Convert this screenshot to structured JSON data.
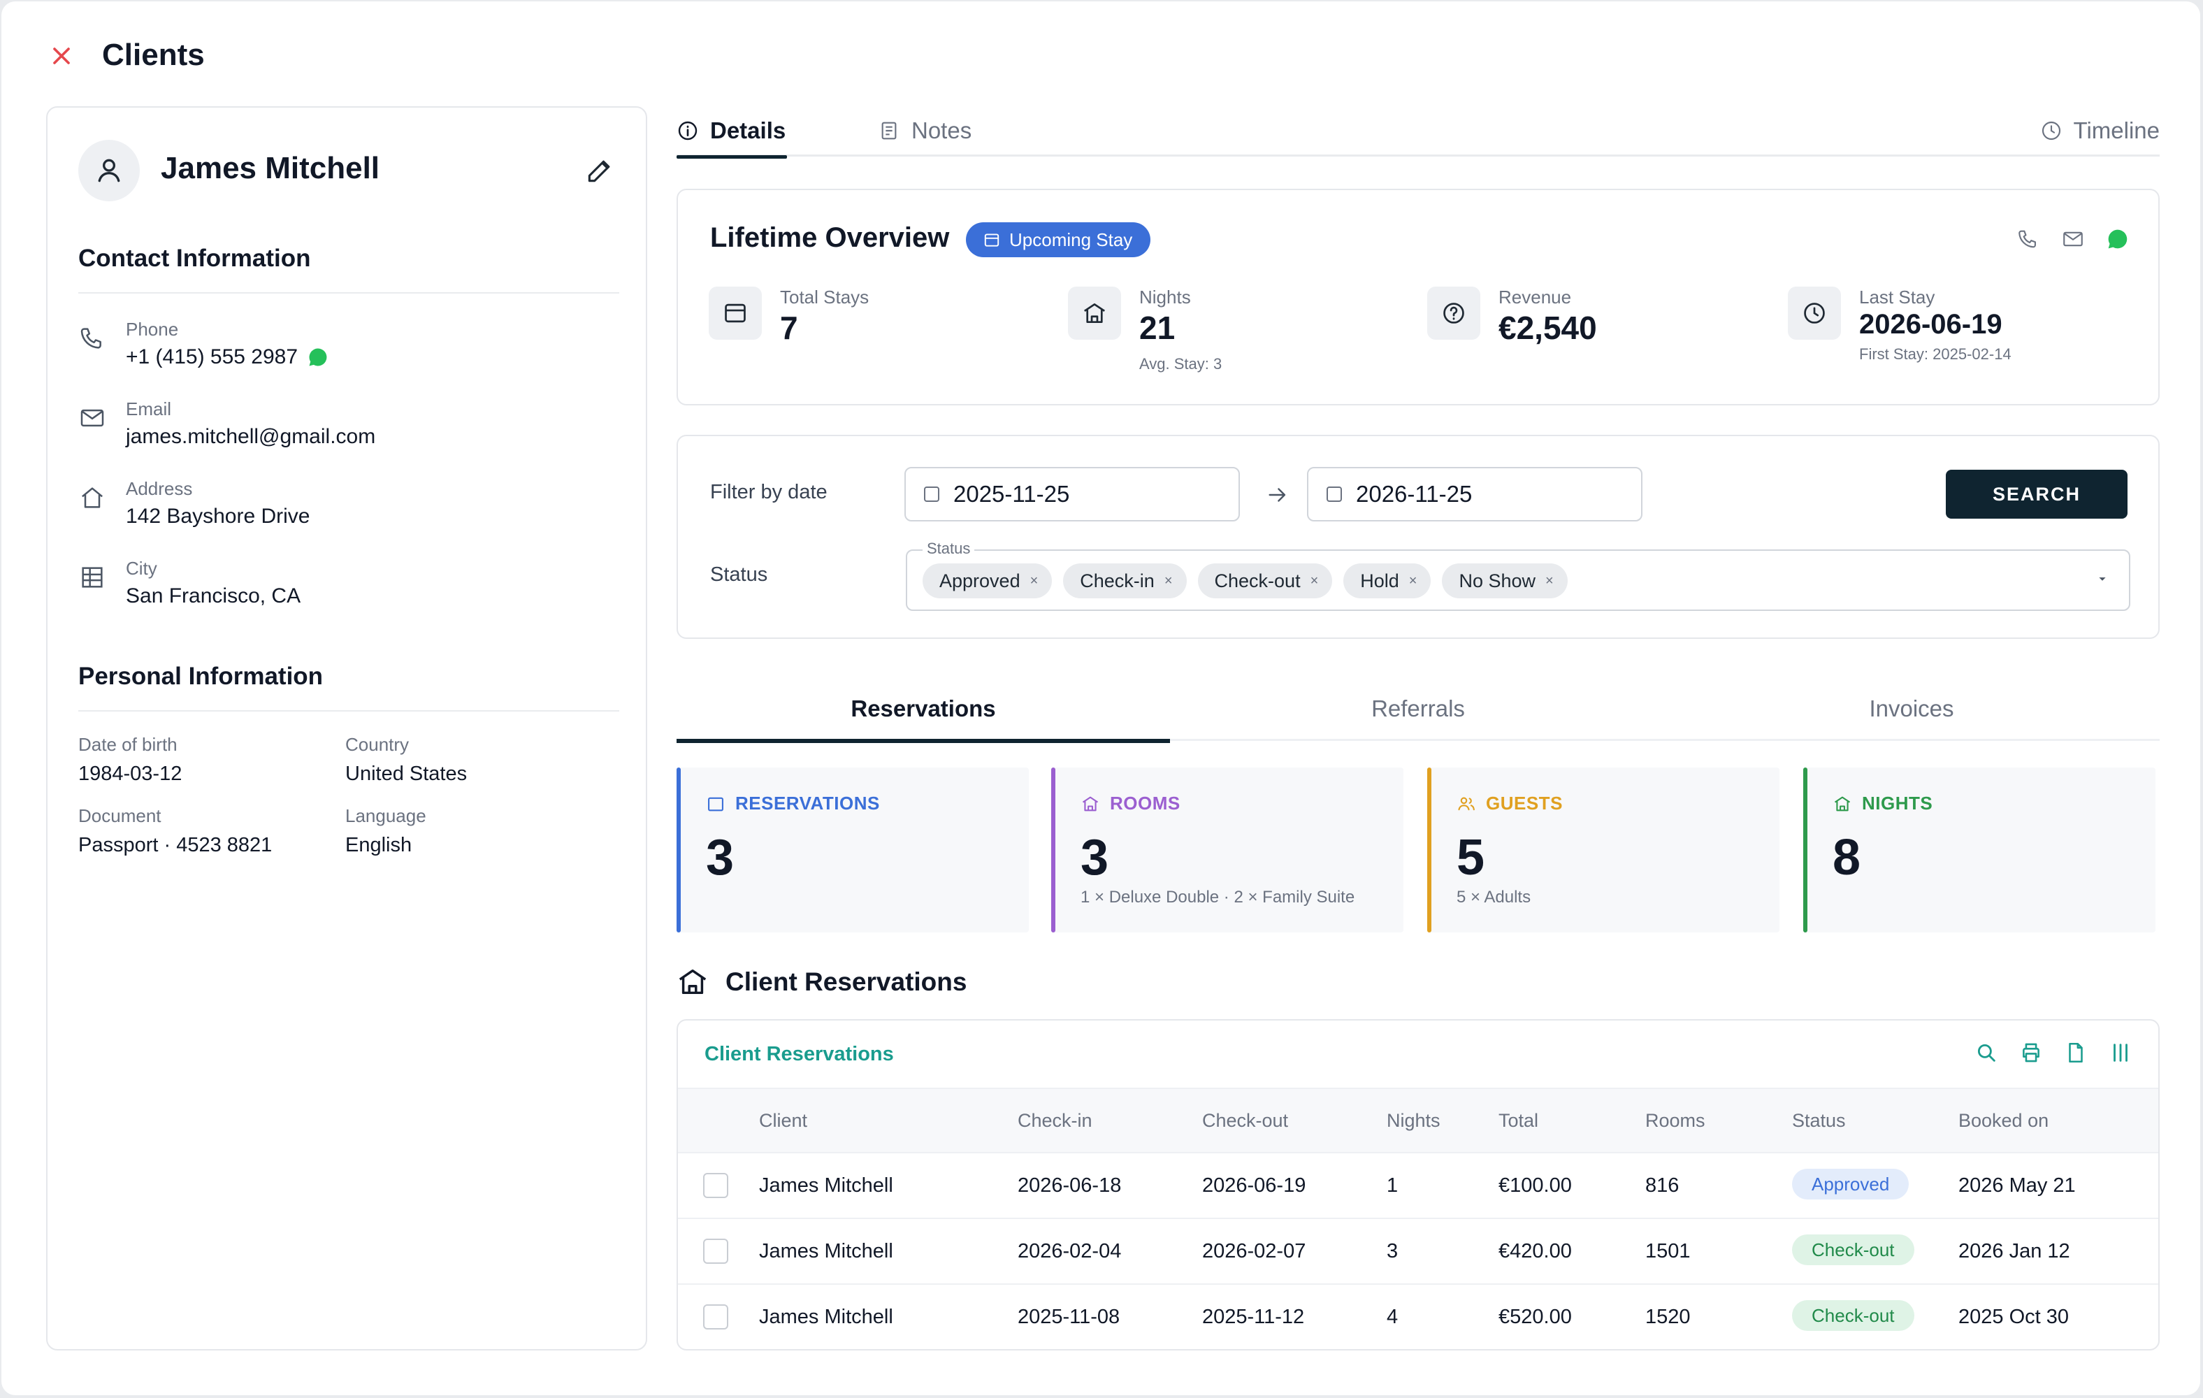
{
  "header": {
    "title": "Clients"
  },
  "client": {
    "name": "James Mitchell",
    "contact_title": "Contact Information",
    "phone_label": "Phone",
    "phone": "+1 (415) 555 2987",
    "email_label": "Email",
    "email": "james.mitchell@gmail.com",
    "address_label": "Address",
    "address": "142 Bayshore Drive",
    "city_label": "City",
    "city": "San Francisco, CA",
    "personal_title": "Personal Information",
    "dob_label": "Date of birth",
    "dob": "1984-03-12",
    "country_label": "Country",
    "country": "United States",
    "document_label": "Document",
    "document": "Passport · 4523 8821",
    "language_label": "Language",
    "language": "English"
  },
  "tabs": {
    "details": "Details",
    "notes": "Notes",
    "timeline": "Timeline"
  },
  "overview": {
    "title": "Lifetime Overview",
    "badge": "Upcoming Stay",
    "total_stays_label": "Total Stays",
    "total_stays": "7",
    "nights_label": "Nights",
    "nights": "21",
    "nights_sub": "Avg. Stay: 3",
    "revenue_label": "Revenue",
    "revenue": "€2,540",
    "last_stay_label": "Last Stay",
    "last_stay": "2026-06-19",
    "last_stay_sub": "First Stay: 2025-02-14"
  },
  "filter": {
    "label": "Filter by date",
    "from": "2025-11-25",
    "to": "2026-11-25",
    "search": "SEARCH",
    "status_label": "Status",
    "status_legend": "Status",
    "chips": [
      "Approved",
      "Check-in",
      "Check-out",
      "Hold",
      "No Show"
    ],
    "chip_remove": "×"
  },
  "subtabs": {
    "reservations": "Reservations",
    "referrals": "Referrals",
    "invoices": "Invoices"
  },
  "tiles": {
    "reservations": {
      "label": "RESERVATIONS",
      "value": "3",
      "color": "#3b6fd8"
    },
    "rooms": {
      "label": "ROOMS",
      "value": "3",
      "sub": "1 × Deluxe Double · 2 × Family Suite",
      "color": "#9b5fd0"
    },
    "guests": {
      "label": "GUESTS",
      "value": "5",
      "sub": "5 × Adults",
      "color": "#e0a020"
    },
    "nights": {
      "label": "NIGHTS",
      "value": "8",
      "color": "#2e9a4c"
    }
  },
  "client_reservations": {
    "heading": "Client Reservations",
    "table_title": "Client Reservations",
    "columns": [
      "Client",
      "Check-in",
      "Check-out",
      "Nights",
      "Total",
      "Rooms",
      "Status",
      "Booked on"
    ],
    "rows": [
      {
        "client": "James Mitchell",
        "checkin": "2026-06-18",
        "checkout": "2026-06-19",
        "nights": "1",
        "total": "€100.00",
        "rooms": "816",
        "status": "Approved",
        "booked": "2026 May 21"
      },
      {
        "client": "James Mitchell",
        "checkin": "2026-02-04",
        "checkout": "2026-02-07",
        "nights": "3",
        "total": "€420.00",
        "rooms": "1501",
        "status": "Check-out",
        "booked": "2026 Jan 12"
      },
      {
        "client": "James Mitchell",
        "checkin": "2025-11-08",
        "checkout": "2025-11-12",
        "nights": "4",
        "total": "€520.00",
        "rooms": "1520",
        "status": "Check-out",
        "booked": "2025 Oct 30"
      }
    ]
  }
}
